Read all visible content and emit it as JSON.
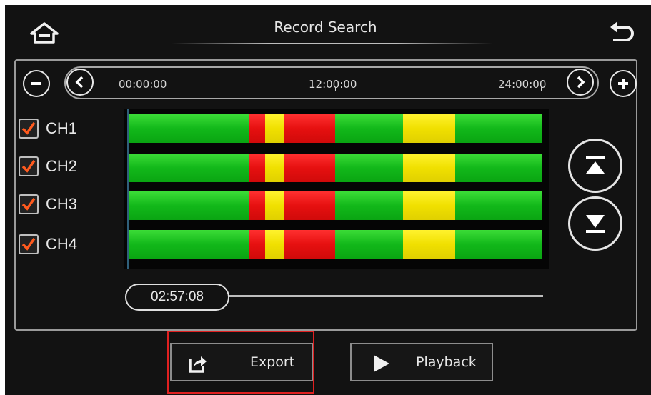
{
  "header": {
    "title": "Record Search",
    "home_icon": "home-icon",
    "back_icon": "back-arrow-icon"
  },
  "timeline": {
    "ticks": [
      "00:00:00",
      "12:00:00",
      "24:00:00"
    ],
    "current_time": "02:57:08",
    "zoom_out_icon": "minus-icon",
    "zoom_in_icon": "plus-icon",
    "prev_icon": "chevron-left-icon",
    "next_icon": "chevron-right-icon"
  },
  "channels": [
    {
      "label": "CH1",
      "checked": true
    },
    {
      "label": "CH2",
      "checked": true
    },
    {
      "label": "CH3",
      "checked": true
    },
    {
      "label": "CH4",
      "checked": true
    }
  ],
  "recording_segments": [
    {
      "type": "normal",
      "color": "#12b81a",
      "fraction": 0.29
    },
    {
      "type": "alarm",
      "color": "#e61010",
      "fraction": 0.04
    },
    {
      "type": "event",
      "color": "#f0e000",
      "fraction": 0.045
    },
    {
      "type": "alarm",
      "color": "#e61010",
      "fraction": 0.125
    },
    {
      "type": "normal",
      "color": "#12b81a",
      "fraction": 0.165
    },
    {
      "type": "event",
      "color": "#f0e000",
      "fraction": 0.125
    },
    {
      "type": "normal",
      "color": "#12b81a",
      "fraction": 0.21
    }
  ],
  "scroll": {
    "top_icon": "scroll-to-top-icon",
    "down_icon": "scroll-down-icon"
  },
  "actions": {
    "export_label": "Export",
    "export_icon": "export-share-icon",
    "playback_label": "Playback",
    "playback_icon": "play-icon"
  },
  "colors": {
    "background": "#121212",
    "highlight": "#e02020",
    "checkmark": "#ff5a1e"
  }
}
